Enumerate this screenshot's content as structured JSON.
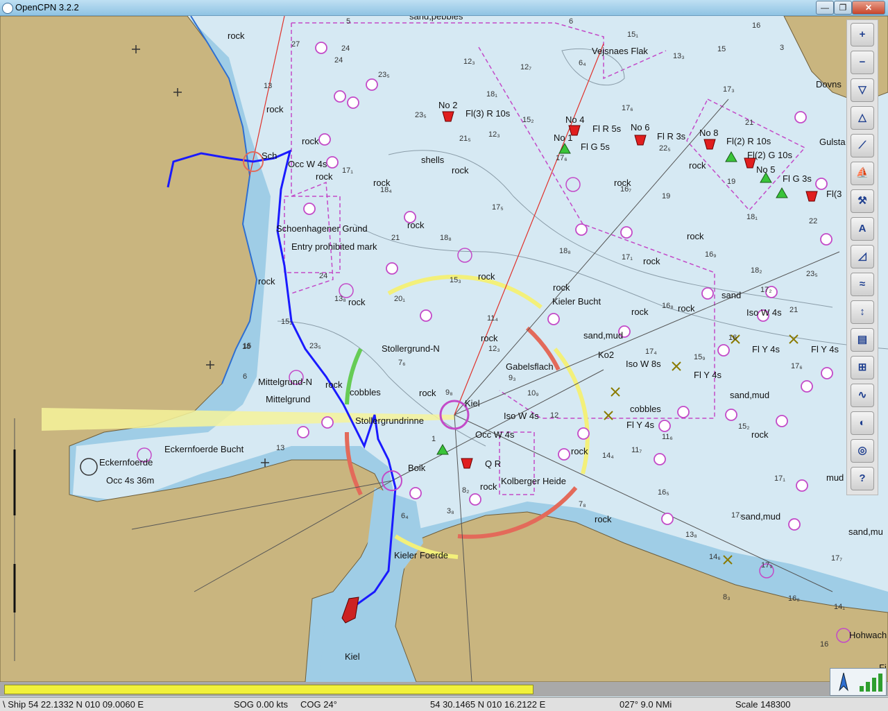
{
  "window": {
    "title": "OpenCPN 3.2.2",
    "minimize": "—",
    "maximize": "❐",
    "close": "✕"
  },
  "colors": {
    "sea_deep": "#d6e9f3",
    "sea_shallow": "#9fcde6",
    "land": "#c9b57f",
    "track": "#1a1aff",
    "chart_magenta": "#c34ac8",
    "progress": "#f1f13b"
  },
  "chart": {
    "labels": [
      {
        "text": "Vejsnaes Flak",
        "tag": "place"
      },
      {
        "text": "rock"
      },
      {
        "text": "rock"
      },
      {
        "text": "rock"
      },
      {
        "text": "rock"
      },
      {
        "text": "rock"
      },
      {
        "text": "rock"
      },
      {
        "text": "rock"
      },
      {
        "text": "rock"
      },
      {
        "text": "rock"
      },
      {
        "text": "rock"
      },
      {
        "text": "rock"
      },
      {
        "text": "rock"
      },
      {
        "text": "rock"
      },
      {
        "text": "rock"
      },
      {
        "text": "rock"
      },
      {
        "text": "rock"
      },
      {
        "text": "rock"
      },
      {
        "text": "rock"
      },
      {
        "text": "rock"
      },
      {
        "text": "rock"
      },
      {
        "text": "rock"
      },
      {
        "text": "rock"
      },
      {
        "text": "rock"
      },
      {
        "text": "rock"
      },
      {
        "text": "sand,pebbles"
      },
      {
        "text": "shells"
      },
      {
        "text": "No 2"
      },
      {
        "text": "Fl(3) R 10s"
      },
      {
        "text": "No 4"
      },
      {
        "text": "Fl R 5s"
      },
      {
        "text": "No 1"
      },
      {
        "text": "Fl G 5s"
      },
      {
        "text": "No 6"
      },
      {
        "text": "Fl R 3s"
      },
      {
        "text": "No 8"
      },
      {
        "text": "Fl(2) R 10s"
      },
      {
        "text": "Fl(2) G 10s"
      },
      {
        "text": "No 5"
      },
      {
        "text": "Fl G 3s"
      },
      {
        "text": "Fl(3"
      },
      {
        "text": "Gulsta"
      },
      {
        "text": "Dovns"
      },
      {
        "text": "Occ W 4s"
      },
      {
        "text": "Schoenhagener Grund"
      },
      {
        "text": "Entry prohibited mark"
      },
      {
        "text": "Kieler Bucht"
      },
      {
        "text": "sand"
      },
      {
        "text": "Iso W 4s"
      },
      {
        "text": "Fl Y 4s"
      },
      {
        "text": "Fl Y 4s"
      },
      {
        "text": "Fl Y 4s"
      },
      {
        "text": "Fl Y 4s"
      },
      {
        "text": "sand,mud"
      },
      {
        "text": "sand,mud"
      },
      {
        "text": "sand,mud"
      },
      {
        "text": "sand,mu"
      },
      {
        "text": "Stollergrund-N"
      },
      {
        "text": "Gabelsflach"
      },
      {
        "text": "Ko2"
      },
      {
        "text": "Iso W 8s"
      },
      {
        "text": "cobbles"
      },
      {
        "text": "cobbles"
      },
      {
        "text": "Mittelgrund-N"
      },
      {
        "text": "Mittelgrund"
      },
      {
        "text": "Kiel"
      },
      {
        "text": "Stollergrundrinne"
      },
      {
        "text": "Iso W 4s"
      },
      {
        "text": "Occ W 4s"
      },
      {
        "text": "Q R"
      },
      {
        "text": "Kolberger Heide"
      },
      {
        "text": "Eckernfoerde Bucht"
      },
      {
        "text": "Eckernfoerde"
      },
      {
        "text": "Occ 4s 36m"
      },
      {
        "text": "Kieler Foerde"
      },
      {
        "text": "Kiel"
      },
      {
        "text": "mud"
      },
      {
        "text": "Hohwach"
      },
      {
        "text": "Fi"
      },
      {
        "text": "Sch"
      },
      {
        "text": "Boik"
      }
    ],
    "depths": [
      "5",
      "27",
      "6",
      "24",
      "24",
      "23₅",
      "12₃",
      "12₇",
      "15₁",
      "16",
      "3",
      "6₄",
      "13₃",
      "15",
      "13",
      "12₃",
      "18₁",
      "17₆",
      "17₃",
      "21",
      "21₅",
      "15₂",
      "23₅",
      "17₆",
      "22₅",
      "17₁",
      "16₇",
      "19",
      "18₄",
      "19",
      "18₁",
      "17₅",
      "21",
      "18₈",
      "18₈",
      "17₁",
      "16₉",
      "22",
      "23₅",
      "15₃",
      "20₁",
      "11₄",
      "13₈",
      "16₈",
      "18₂",
      "21",
      "15₂",
      "24",
      "23₅",
      "15",
      "16",
      "12₃",
      "7₆",
      "9₃",
      "10₉",
      "15₉",
      "17₄",
      "9₈",
      "12",
      "14₄",
      "11₇",
      "11₆",
      "15₂",
      "16₅",
      "17₁",
      "13₈",
      "14₆",
      "17₇",
      "16₈",
      "17₇",
      "14₁",
      "16",
      "8₃",
      "7₈",
      "8₂",
      "3₈",
      "6₄",
      "1",
      "6",
      "13",
      "18",
      "17₂",
      "17₆",
      "17₉"
    ]
  },
  "status": {
    "ship": "\\ Ship 54 22.1332 N   010 09.0060 E",
    "sog": "SOG 0.00 kts",
    "cog": "COG 24°",
    "cursor_pos": "54 30.1465 N   010 16.2122 E",
    "bearing_dist": "027°  9.0 NMi",
    "scale": "Scale 148300"
  },
  "chart_load_progress": 0.6,
  "toolbar": [
    {
      "name": "zoom-in",
      "glyph": "+"
    },
    {
      "name": "zoom-out",
      "glyph": "−"
    },
    {
      "name": "scale-in",
      "glyph": "▽"
    },
    {
      "name": "scale-out",
      "glyph": "△"
    },
    {
      "name": "route",
      "glyph": "⟋"
    },
    {
      "name": "auto-follow",
      "glyph": "⛵"
    },
    {
      "name": "settings",
      "glyph": "⚒"
    },
    {
      "name": "text",
      "glyph": "A"
    },
    {
      "name": "current",
      "glyph": "◿"
    },
    {
      "name": "tide",
      "glyph": "≈"
    },
    {
      "name": "print-tide",
      "glyph": "↕"
    },
    {
      "name": "print",
      "glyph": "▤"
    },
    {
      "name": "route-manager",
      "glyph": "⊞"
    },
    {
      "name": "track",
      "glyph": "∿"
    },
    {
      "name": "color-scheme",
      "glyph": "◐"
    },
    {
      "name": "mob",
      "glyph": "◎"
    },
    {
      "name": "help",
      "glyph": "?"
    }
  ]
}
